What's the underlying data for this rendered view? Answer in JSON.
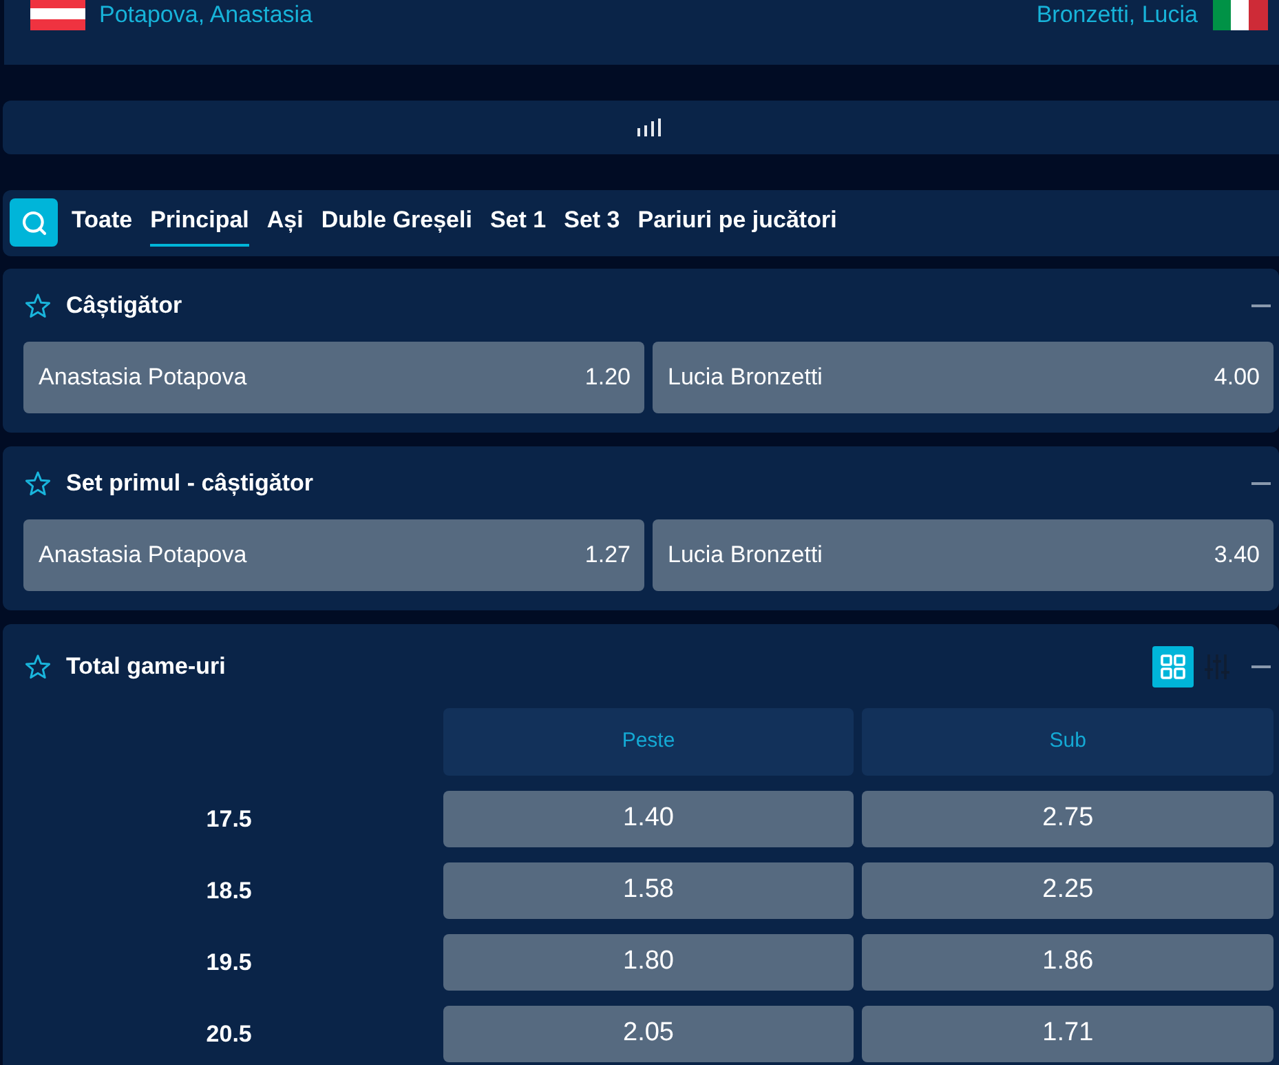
{
  "match": {
    "home": {
      "name": "Potapova, Anastasia"
    },
    "away": {
      "name": "Bronzetti, Lucia"
    }
  },
  "tabs": [
    {
      "label": "Toate",
      "selected": false
    },
    {
      "label": "Principal",
      "selected": true
    },
    {
      "label": "Ași",
      "selected": false
    },
    {
      "label": "Duble Greșeli",
      "selected": false
    },
    {
      "label": "Set 1",
      "selected": false
    },
    {
      "label": "Set 3",
      "selected": false
    },
    {
      "label": "Pariuri pe jucători",
      "selected": false
    }
  ],
  "markets": [
    {
      "title": "Câștigător",
      "kind": "buttons",
      "starred": false,
      "expanded": true,
      "selections": [
        {
          "name": "Anastasia Potapova",
          "odds": "1.20"
        },
        {
          "name": "Lucia Bronzetti",
          "odds": "4.00"
        }
      ]
    },
    {
      "title": "Set primul - câștigător",
      "kind": "buttons",
      "starred": false,
      "expanded": true,
      "selections": [
        {
          "name": "Anastasia Potapova",
          "odds": "1.27"
        },
        {
          "name": "Lucia Bronzetti",
          "odds": "3.40"
        }
      ]
    },
    {
      "title": "Total game-uri",
      "kind": "table",
      "starred": false,
      "expanded": true,
      "view_options": [
        {
          "kind": "grid",
          "selected": true
        },
        {
          "kind": "sliders",
          "selected": false
        }
      ],
      "columns": [
        "Peste",
        "Sub"
      ],
      "rows": [
        {
          "line": "17.5",
          "odds": [
            "1.40",
            "2.75"
          ]
        },
        {
          "line": "18.5",
          "odds": [
            "1.58",
            "2.25"
          ]
        },
        {
          "line": "19.5",
          "odds": [
            "1.80",
            "1.86"
          ]
        },
        {
          "line": "20.5",
          "odds": [
            "2.05",
            "1.71"
          ]
        }
      ]
    }
  ]
}
